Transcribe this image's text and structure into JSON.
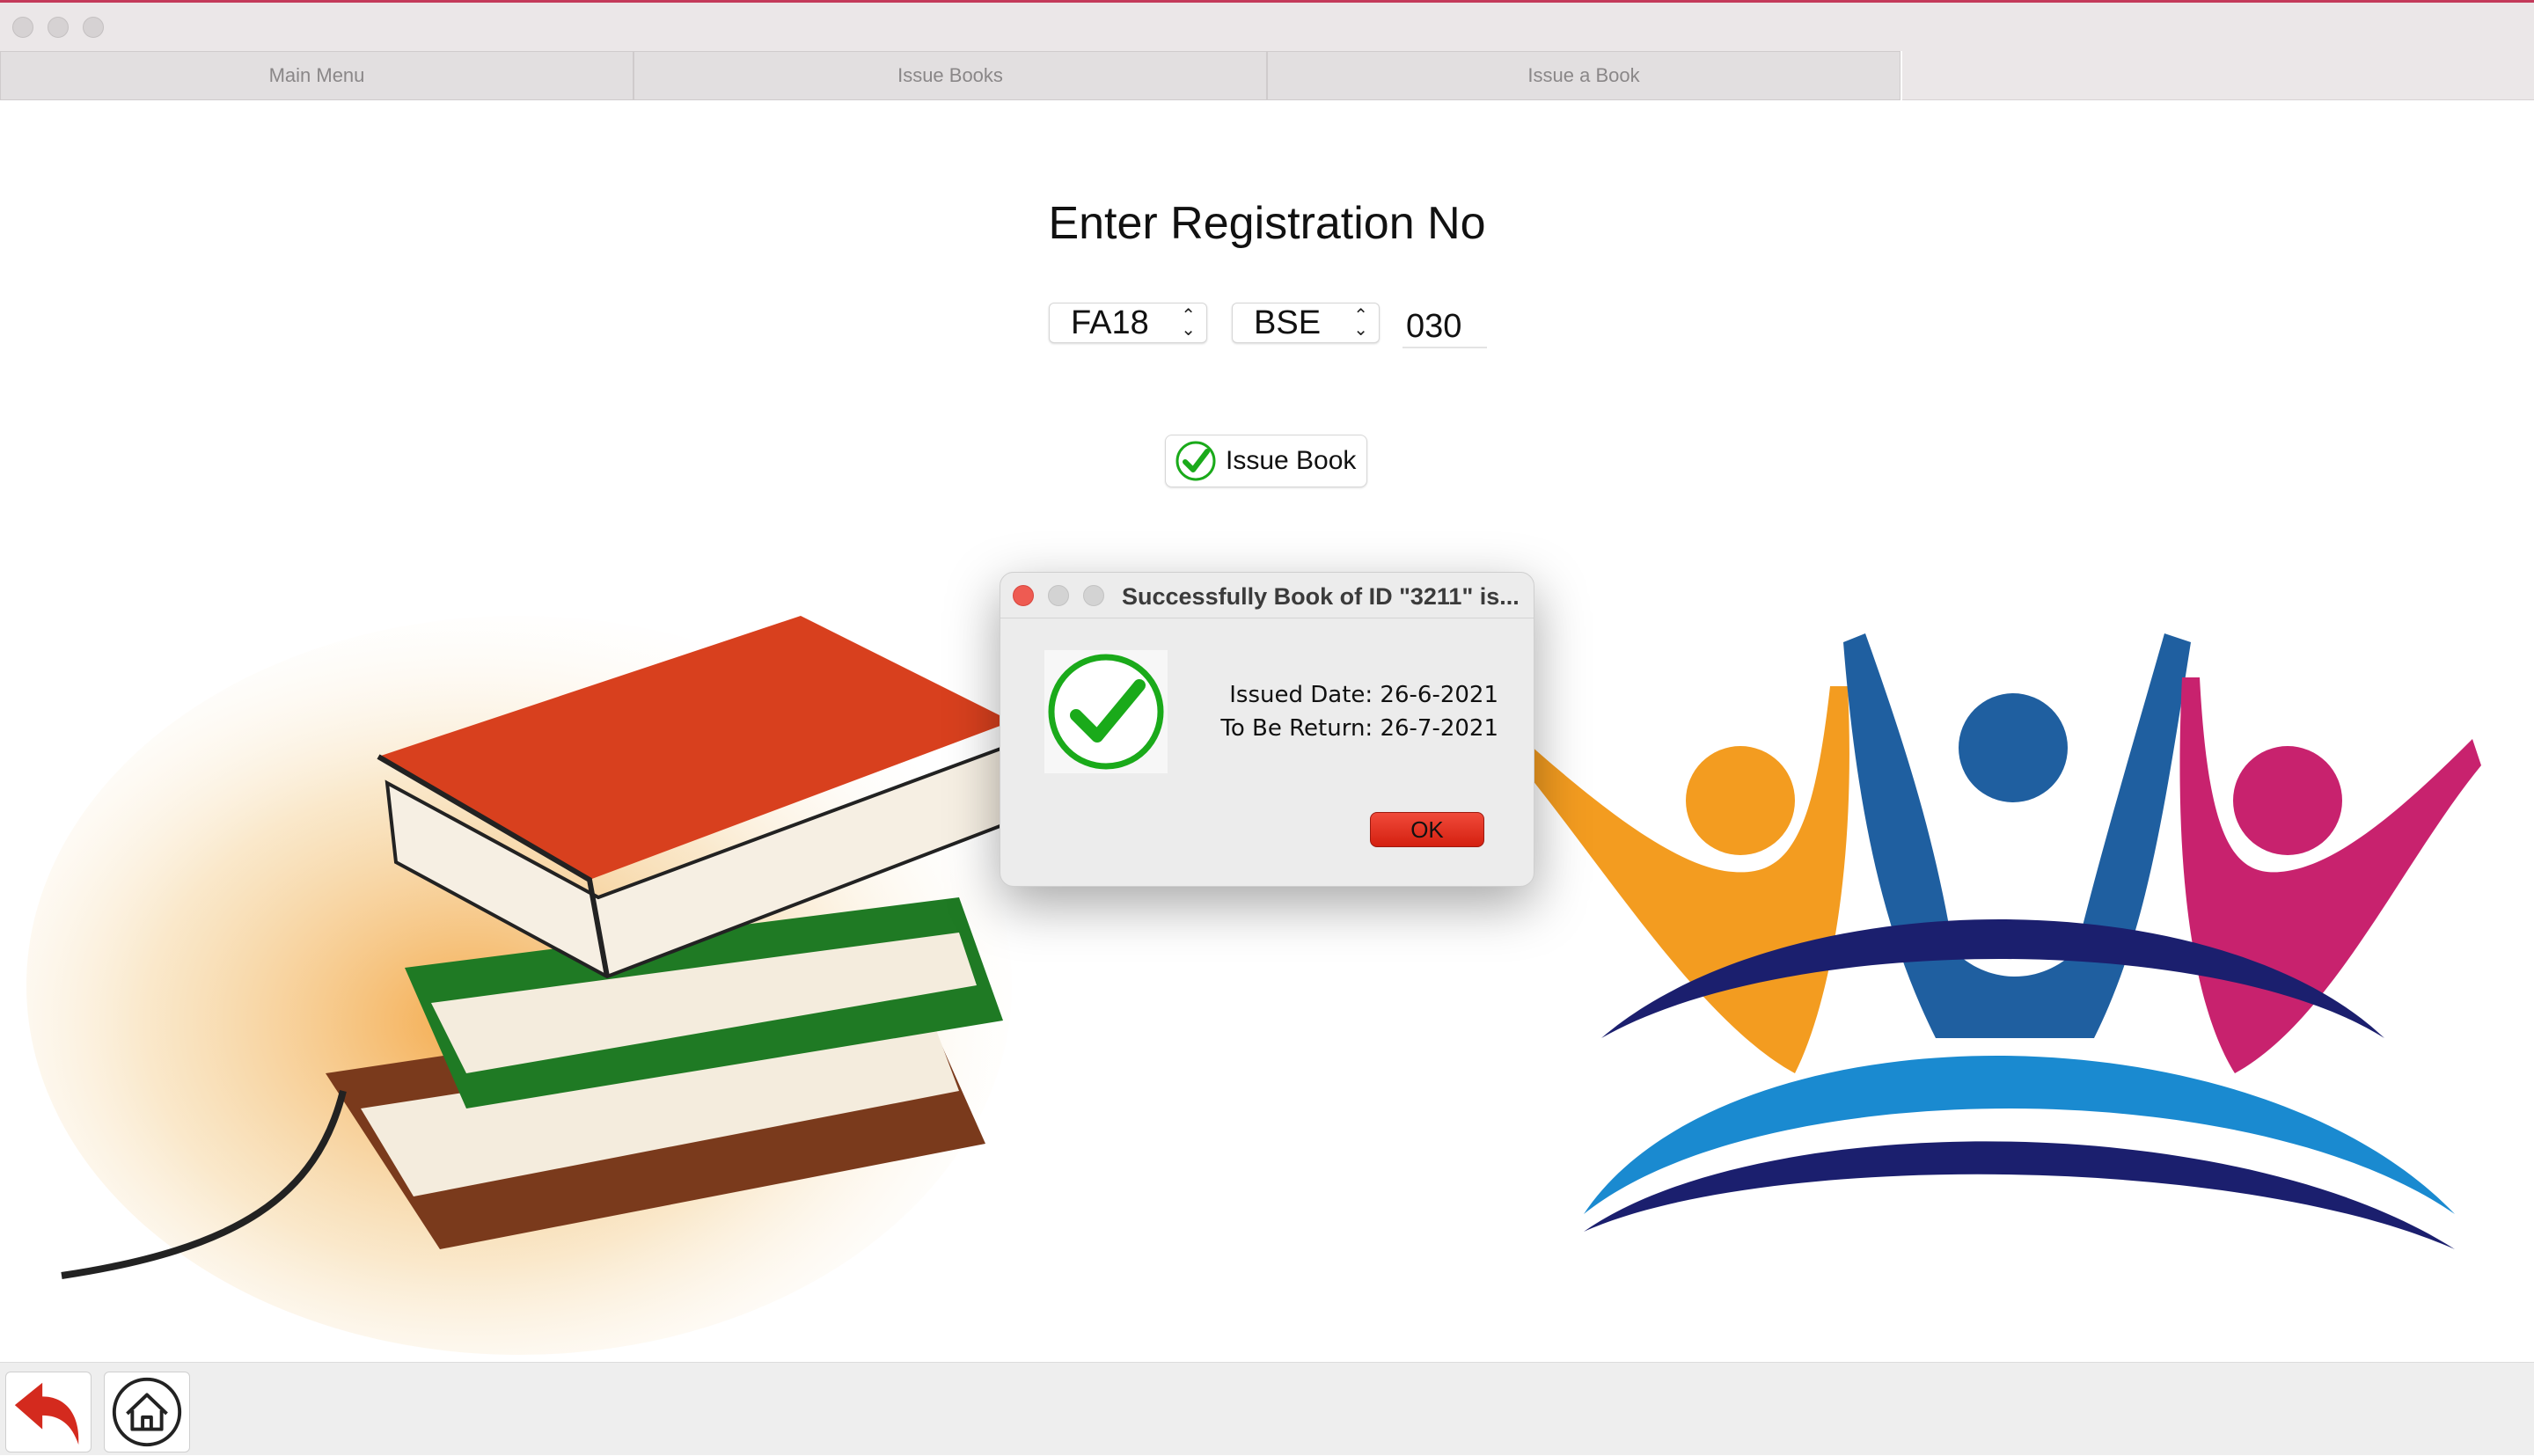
{
  "window": {
    "tabs": [
      {
        "label": "Main Menu"
      },
      {
        "label": "Issue Books"
      },
      {
        "label": "Issue a Book"
      }
    ]
  },
  "form": {
    "heading": "Enter Registration No",
    "session_select": {
      "value": "FA18"
    },
    "program_select": {
      "value": "BSE"
    },
    "roll_number": {
      "value": "030"
    },
    "issue_button": {
      "label": "Issue Book",
      "icon": "check-circle-icon"
    }
  },
  "dialog": {
    "title": "Successfully Book of ID \"3211\" is...",
    "icon": "check-icon",
    "issued_date_line": "Issued Date: 26-6-2021",
    "return_date_line": "To Be Return: 26-7-2021",
    "ok_label": "OK"
  },
  "bottom_bar": {
    "back_icon": "back-arrow-icon",
    "home_icon": "home-icon"
  },
  "colors": {
    "accent_red": "#d42010",
    "check_green": "#1aaa1a",
    "tab_bg": "#e2dfe0"
  }
}
